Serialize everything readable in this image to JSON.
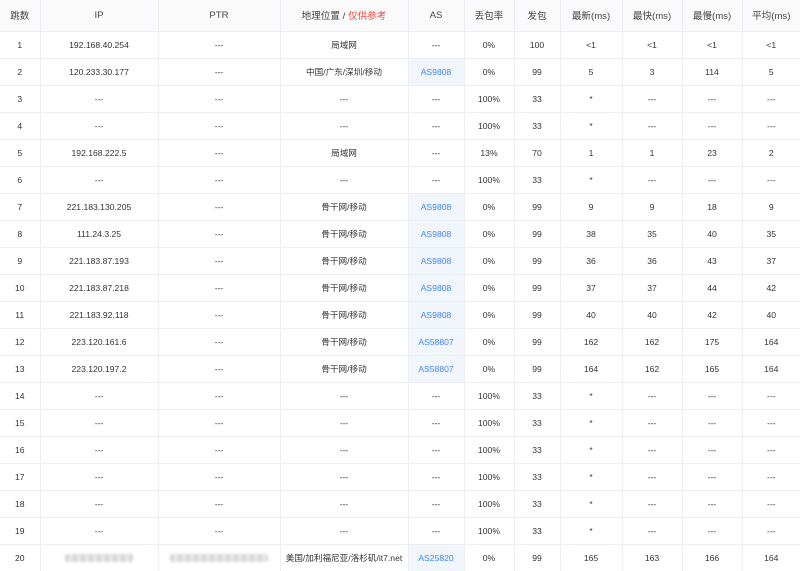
{
  "headers": {
    "hop": "跳数",
    "ip": "IP",
    "ptr": "PTR",
    "geo": "地理位置 /",
    "geo_note": "仅供参考",
    "as": "AS",
    "loss": "丢包率",
    "sent": "发包",
    "last": "最新(ms)",
    "best": "最快(ms)",
    "worst": "最慢(ms)",
    "avg": "平均(ms)"
  },
  "rows": [
    {
      "hop": "1",
      "ip": "192.168.40.254",
      "ptr": "---",
      "geo": "局域网",
      "as": "---",
      "loss": "0%",
      "sent": "100",
      "last": "<1",
      "best": "<1",
      "worst": "<1",
      "avg": "<1"
    },
    {
      "hop": "2",
      "ip": "120.233.30.177",
      "ptr": "---",
      "geo": "中国/广东/深圳/移动",
      "as": "AS9808",
      "loss": "0%",
      "sent": "99",
      "last": "5",
      "best": "3",
      "worst": "114",
      "avg": "5"
    },
    {
      "hop": "3",
      "ip": "---",
      "ptr": "---",
      "geo": "---",
      "as": "---",
      "loss": "100%",
      "sent": "33",
      "last": "*",
      "best": "---",
      "worst": "---",
      "avg": "---"
    },
    {
      "hop": "4",
      "ip": "---",
      "ptr": "---",
      "geo": "---",
      "as": "---",
      "loss": "100%",
      "sent": "33",
      "last": "*",
      "best": "---",
      "worst": "---",
      "avg": "---"
    },
    {
      "hop": "5",
      "ip": "192.168.222.5",
      "ptr": "---",
      "geo": "局域网",
      "as": "---",
      "loss": "13%",
      "sent": "70",
      "last": "1",
      "best": "1",
      "worst": "23",
      "avg": "2"
    },
    {
      "hop": "6",
      "ip": "---",
      "ptr": "---",
      "geo": "---",
      "as": "---",
      "loss": "100%",
      "sent": "33",
      "last": "*",
      "best": "---",
      "worst": "---",
      "avg": "---"
    },
    {
      "hop": "7",
      "ip": "221.183.130.205",
      "ptr": "---",
      "geo": "骨干网/移动",
      "as": "AS9808",
      "loss": "0%",
      "sent": "99",
      "last": "9",
      "best": "9",
      "worst": "18",
      "avg": "9"
    },
    {
      "hop": "8",
      "ip": "111.24.3.25",
      "ptr": "---",
      "geo": "骨干网/移动",
      "as": "AS9808",
      "loss": "0%",
      "sent": "99",
      "last": "38",
      "best": "35",
      "worst": "40",
      "avg": "35"
    },
    {
      "hop": "9",
      "ip": "221.183.87.193",
      "ptr": "---",
      "geo": "骨干网/移动",
      "as": "AS9808",
      "loss": "0%",
      "sent": "99",
      "last": "36",
      "best": "36",
      "worst": "43",
      "avg": "37"
    },
    {
      "hop": "10",
      "ip": "221.183.87.218",
      "ptr": "---",
      "geo": "骨干网/移动",
      "as": "AS9808",
      "loss": "0%",
      "sent": "99",
      "last": "37",
      "best": "37",
      "worst": "44",
      "avg": "42"
    },
    {
      "hop": "11",
      "ip": "221.183.92.118",
      "ptr": "---",
      "geo": "骨干网/移动",
      "as": "AS9808",
      "loss": "0%",
      "sent": "99",
      "last": "40",
      "best": "40",
      "worst": "42",
      "avg": "40"
    },
    {
      "hop": "12",
      "ip": "223.120.161.6",
      "ptr": "---",
      "geo": "骨干网/移动",
      "as": "AS58807",
      "loss": "0%",
      "sent": "99",
      "last": "162",
      "best": "162",
      "worst": "175",
      "avg": "164"
    },
    {
      "hop": "13",
      "ip": "223.120.197.2",
      "ptr": "---",
      "geo": "骨干网/移动",
      "as": "AS58807",
      "loss": "0%",
      "sent": "99",
      "last": "164",
      "best": "162",
      "worst": "165",
      "avg": "164"
    },
    {
      "hop": "14",
      "ip": "---",
      "ptr": "---",
      "geo": "---",
      "as": "---",
      "loss": "100%",
      "sent": "33",
      "last": "*",
      "best": "---",
      "worst": "---",
      "avg": "---"
    },
    {
      "hop": "15",
      "ip": "---",
      "ptr": "---",
      "geo": "---",
      "as": "---",
      "loss": "100%",
      "sent": "33",
      "last": "*",
      "best": "---",
      "worst": "---",
      "avg": "---"
    },
    {
      "hop": "16",
      "ip": "---",
      "ptr": "---",
      "geo": "---",
      "as": "---",
      "loss": "100%",
      "sent": "33",
      "last": "*",
      "best": "---",
      "worst": "---",
      "avg": "---"
    },
    {
      "hop": "17",
      "ip": "---",
      "ptr": "---",
      "geo": "---",
      "as": "---",
      "loss": "100%",
      "sent": "33",
      "last": "*",
      "best": "---",
      "worst": "---",
      "avg": "---"
    },
    {
      "hop": "18",
      "ip": "---",
      "ptr": "---",
      "geo": "---",
      "as": "---",
      "loss": "100%",
      "sent": "33",
      "last": "*",
      "best": "---",
      "worst": "---",
      "avg": "---"
    },
    {
      "hop": "19",
      "ip": "---",
      "ptr": "---",
      "geo": "---",
      "as": "---",
      "loss": "100%",
      "sent": "33",
      "last": "*",
      "best": "---",
      "worst": "---",
      "avg": "---"
    },
    {
      "hop": "20",
      "ip": "",
      "ptr": "",
      "geo": "美国/加利福尼亚/洛杉矶/it7.net",
      "as": "AS25820",
      "loss": "0%",
      "sent": "99",
      "last": "165",
      "best": "163",
      "worst": "166",
      "avg": "164",
      "ip_hidden": true,
      "ptr_hidden": true
    }
  ],
  "colors": {
    "header_bg": "#fafafa",
    "border": "#ebeef5",
    "link": "#3f86f2",
    "as_cell_bg": "#f1f6fd",
    "warning": "#ee4c4c"
  }
}
